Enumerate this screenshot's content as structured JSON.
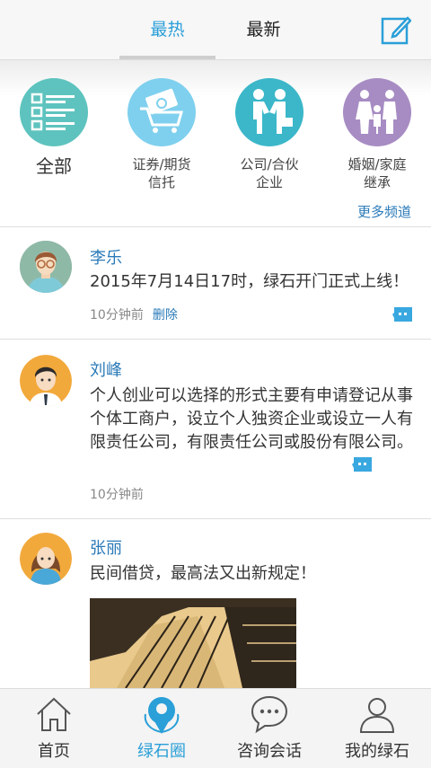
{
  "header": {
    "tab_hot": "最热",
    "tab_new": "最新",
    "edit_icon": "edit-icon"
  },
  "categories": [
    {
      "label": "全部",
      "icon": "list-icon",
      "color": "#5ec3be"
    },
    {
      "label": "证券/期货信托",
      "line1": "证券/期货",
      "line2": "信托",
      "icon": "cart-money-icon",
      "color": "#7fd0ee"
    },
    {
      "label": "公司/合伙企业",
      "line1": "公司/合伙",
      "line2": "企业",
      "icon": "handshake-icon",
      "color": "#3bb7c9"
    },
    {
      "label": "婚姻/家庭继承",
      "line1": "婚姻/家庭",
      "line2": "继承",
      "icon": "family-icon",
      "color": "#a78cc3"
    }
  ],
  "more_channels": "更多频道",
  "posts": [
    {
      "name": "李乐",
      "content": "2015年7月14日17时，绿石开门正式上线！",
      "time": "10分钟前",
      "delete": "删除"
    },
    {
      "name": "刘峰",
      "content": "个人创业可以选择的形式主要有申请登记从事个体工商户，设立个人独资企业或设立一人有限责任公司，有限责任公司或股份有限公司。",
      "time": "10分钟前"
    },
    {
      "name": "张丽",
      "content": "民间借贷，最高法又出新规定！"
    }
  ],
  "nav": [
    {
      "label": "首页",
      "icon": "home-icon"
    },
    {
      "label": "绿石圈",
      "icon": "lvshi-circle-icon"
    },
    {
      "label": "咨询会话",
      "icon": "chat-icon"
    },
    {
      "label": "我的绿石",
      "icon": "user-icon"
    }
  ],
  "colors": {
    "accent": "#2a9fd8",
    "link": "#2a7ab8"
  }
}
